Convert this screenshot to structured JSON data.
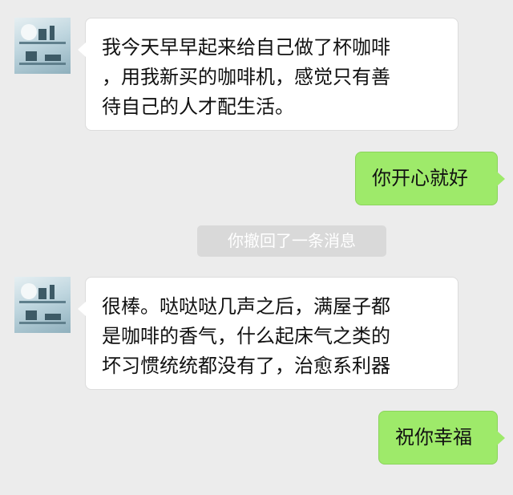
{
  "messages": [
    {
      "side": "left",
      "lines": [
        "我今天早早起来给自己做了杯咖啡",
        "，用我新买的咖啡机，感觉只有善",
        "待自己的人才配生活。"
      ]
    },
    {
      "side": "right",
      "lines": [
        "你开心就好"
      ]
    },
    {
      "side": "left",
      "lines": [
        "很棒。哒哒哒几声之后，满屋子都",
        "是咖啡的香气，什么起床气之类的",
        "坏习惯统统都没有了，治愈系利器"
      ]
    },
    {
      "side": "right",
      "lines": [
        "祝你幸福"
      ]
    }
  ],
  "system_notice": "你撤回了一条消息",
  "colors": {
    "background": "#ececec",
    "incoming_bubble": "#ffffff",
    "outgoing_bubble": "#9eea6a",
    "notice_background": "#d9d9d9"
  }
}
